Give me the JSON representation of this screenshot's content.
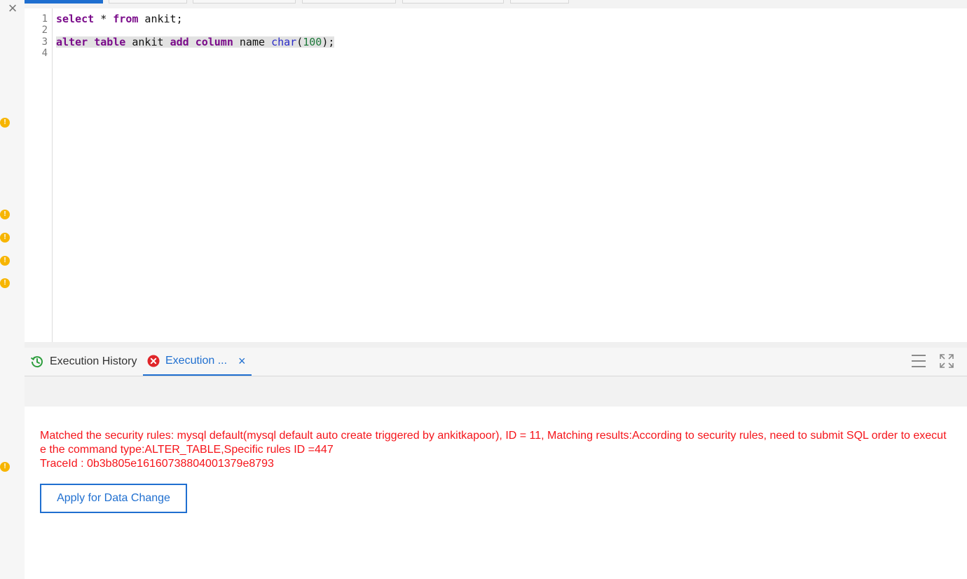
{
  "window": {
    "close_glyph": "×"
  },
  "editor": {
    "lines": [
      {
        "num": "1"
      },
      {
        "num": "2"
      },
      {
        "num": "3"
      },
      {
        "num": "4"
      }
    ],
    "code": {
      "line1": {
        "kw1": "select",
        "t1": " * ",
        "kw2": "from",
        "t2": " ankit;"
      },
      "line3": {
        "kw1": "alter",
        "kw2": "table",
        "t1": " ankit ",
        "kw3": "add",
        "kw4": "column",
        "t2": " name ",
        "ty": "char",
        "p1": "(",
        "n": "100",
        "p2": ");"
      }
    }
  },
  "result_panel": {
    "tabs": [
      {
        "label": "Execution History",
        "icon": "history-icon",
        "icon_color": "#2e9e3e"
      },
      {
        "label": "Execution ...",
        "icon": "error-icon",
        "icon_color": "#e0262a",
        "active": true,
        "close": "×"
      }
    ],
    "tools": [
      "list-icon",
      "fullscreen-icon"
    ],
    "error": {
      "message": "Matched the security rules: mysql default(mysql default auto create triggered by ankitkapoor), ID = 11, Matching results:According to security rules, need to submit SQL order to execute the command type:ALTER_TABLE,Specific rules ID =447",
      "trace": "TraceId : 0b3b805e16160738804001379e8793"
    },
    "apply_button": "Apply for Data Change"
  },
  "colors": {
    "accent": "#1f6fd0",
    "error_text": "#f5141a",
    "warning": "#f7b500",
    "keyword": "#7a0b8a"
  }
}
